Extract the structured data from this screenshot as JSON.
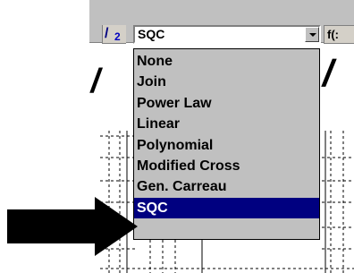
{
  "toolbar": {
    "left_button_number": "2",
    "combo_value": "SQC",
    "right_button_label": "f(:"
  },
  "dropdown": {
    "items": [
      "None",
      "Join",
      "Power Law",
      "Linear",
      "Polynomial",
      "Modified Cross",
      "Gen. Carreau",
      "SQC"
    ],
    "selected": "SQC"
  },
  "colors": {
    "selection": "#000080",
    "toolbar": "#c0c0c0"
  }
}
